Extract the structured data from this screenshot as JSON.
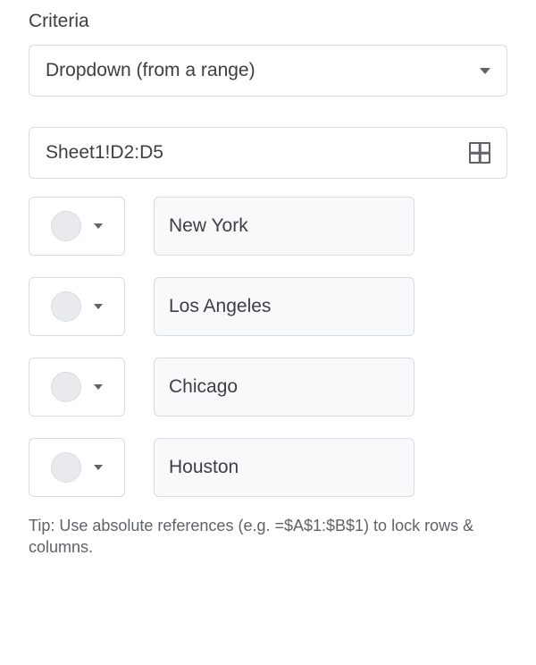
{
  "section_label": "Criteria",
  "criteria_type": "Dropdown (from a range)",
  "range_value": "Sheet1!D2:D5",
  "options": [
    {
      "label": "New York"
    },
    {
      "label": "Los Angeles"
    },
    {
      "label": "Chicago"
    },
    {
      "label": "Houston"
    }
  ],
  "tip": "Tip: Use absolute references (e.g. =$A$1:$B$1) to lock rows & columns."
}
